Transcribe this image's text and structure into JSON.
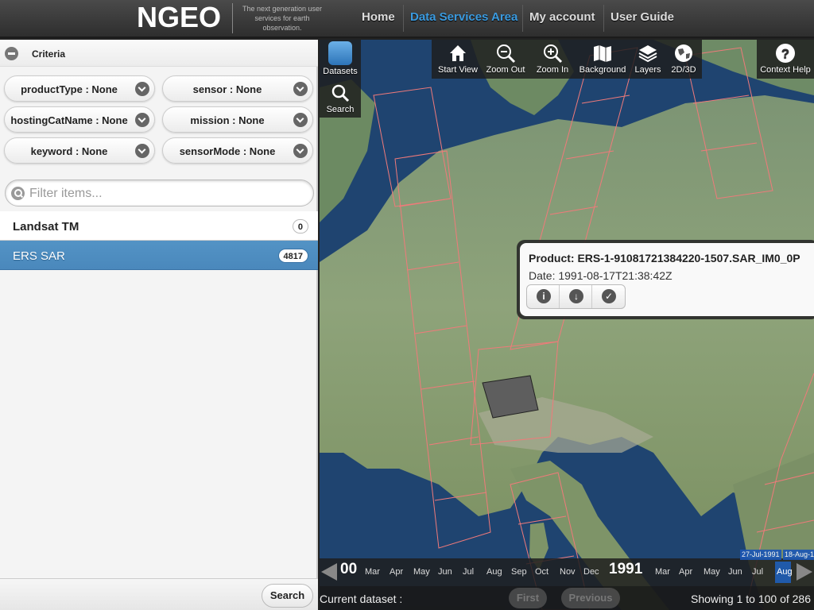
{
  "header": {
    "logo": "NGEO",
    "tagline": "The next generation user services for earth observation.",
    "nav": [
      {
        "label": "Home",
        "active": false
      },
      {
        "label": "Data Services Area",
        "active": true
      },
      {
        "label": "My account",
        "active": false
      },
      {
        "label": "User Guide",
        "active": false
      }
    ]
  },
  "criteria": {
    "title": "Criteria",
    "fields": [
      {
        "label": "productType : None"
      },
      {
        "label": "sensor : None"
      },
      {
        "label": "hostingCatName : None"
      },
      {
        "label": "mission : None"
      },
      {
        "label": "keyword : None"
      },
      {
        "label": "sensorMode : None"
      }
    ]
  },
  "filter": {
    "placeholder": "Filter items...",
    "value": ""
  },
  "datasets": [
    {
      "name": "Landsat TM",
      "count": "0",
      "selected": false
    },
    {
      "name": "ERS SAR",
      "count": "4817",
      "selected": true
    }
  ],
  "left_footer": {
    "search_label": "Search"
  },
  "map": {
    "toolbar": {
      "left": [
        {
          "label": "Datasets",
          "icon": "database-icon"
        },
        {
          "label": "Search",
          "icon": "search-icon"
        }
      ],
      "center": [
        {
          "label": "Start View",
          "icon": "home-icon"
        },
        {
          "label": "Zoom Out",
          "icon": "zoom-out-icon"
        },
        {
          "label": "Zoom In",
          "icon": "zoom-in-icon"
        },
        {
          "label": "Background",
          "icon": "map-icon"
        },
        {
          "label": "Layers",
          "icon": "layers-icon"
        },
        {
          "label": "2D/3D",
          "icon": "globe-icon"
        }
      ],
      "right": [
        {
          "label": "Context Help",
          "icon": "help-icon"
        }
      ]
    },
    "popup": {
      "product": "Product: ERS-1-91081721384220-1507.SAR_IM0_0P",
      "date": "Date: 1991-08-17T21:38:42Z",
      "actions": [
        "info-icon",
        "download-icon",
        "check-icon"
      ]
    },
    "timeline": {
      "year_prev_fragment": "00",
      "months_before": [
        "Mar",
        "Apr",
        "May",
        "Jun",
        "Jul",
        "Aug",
        "Sep",
        "Oct",
        "Nov",
        "Dec"
      ],
      "year": "1991",
      "months_after": [
        "Mar",
        "Apr",
        "May",
        "Jun",
        "Jul",
        "Aug"
      ],
      "range_start": "27-Jul-1991",
      "range_end": "18-Aug-1"
    },
    "status": {
      "current_dataset": "Current dataset :",
      "first": "First",
      "previous": "Previous",
      "showing": "Showing 1 to 100 of 286"
    }
  },
  "colors": {
    "accent": "#3b9be0",
    "selected_row": "#4a88bc",
    "footprint": "#f07a7a"
  }
}
